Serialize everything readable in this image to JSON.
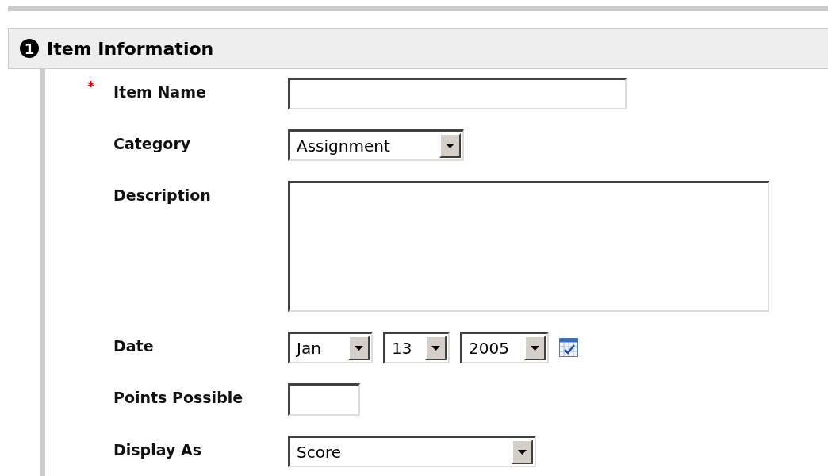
{
  "section": {
    "number": "1",
    "title": "Item Information"
  },
  "required_marker": "*",
  "fields": [
    {
      "kind": "text",
      "label": "Item Name",
      "required": true
    },
    {
      "kind": "select",
      "label": "Category",
      "required": false,
      "value": "Assignment"
    },
    {
      "kind": "textarea",
      "label": "Description",
      "required": false
    },
    {
      "kind": "date",
      "label": "Date",
      "required": false,
      "parts": [
        "Jan",
        "13",
        "2005"
      ]
    },
    {
      "kind": "short-text",
      "label": "Points Possible",
      "required": false
    },
    {
      "kind": "long-select",
      "label": "Display As",
      "required": false,
      "value": "Score"
    }
  ]
}
